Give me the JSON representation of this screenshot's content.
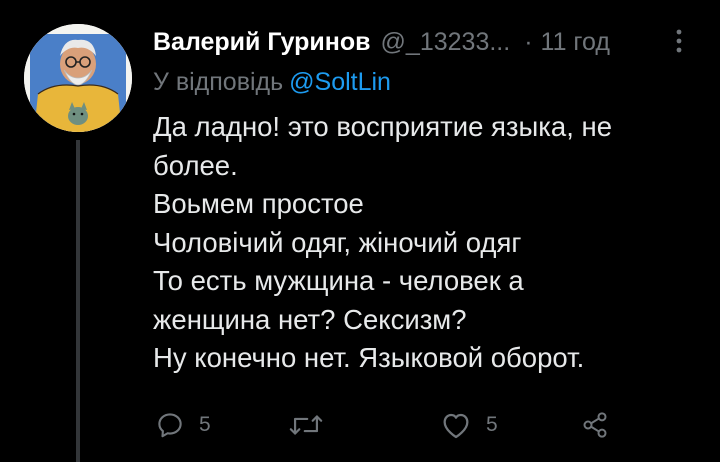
{
  "tweet": {
    "display_name": "Валерий Гуринов",
    "handle": "@_13233...",
    "separator": "·",
    "time": "11 год",
    "reply_prefix": "У відповідь",
    "reply_mention": "@SoltLin",
    "body_lines": [
      "Да ладно! это восприятие языка, не",
      "более.",
      "Воьмем простое",
      "Чоловічий одяг, жіночий одяг",
      "То есть мужщина - человек а",
      "женщина нет? Сексизм?",
      "Ну конечно нет. Языковой оборот."
    ]
  },
  "actions": {
    "reply": {
      "icon": "reply-icon",
      "count": "5"
    },
    "retweet": {
      "icon": "retweet-icon",
      "count": ""
    },
    "like": {
      "icon": "heart-icon",
      "count": "5"
    },
    "share": {
      "icon": "share-icon"
    }
  },
  "icons": {
    "more": "more-vertical-icon",
    "avatar": "avatar-illustration"
  },
  "colors": {
    "background": "#000000",
    "name": "#ffffff",
    "muted": "#71767b",
    "link": "#1d9bf0",
    "text": "#e7e9ea",
    "thread_line": "#333639"
  }
}
